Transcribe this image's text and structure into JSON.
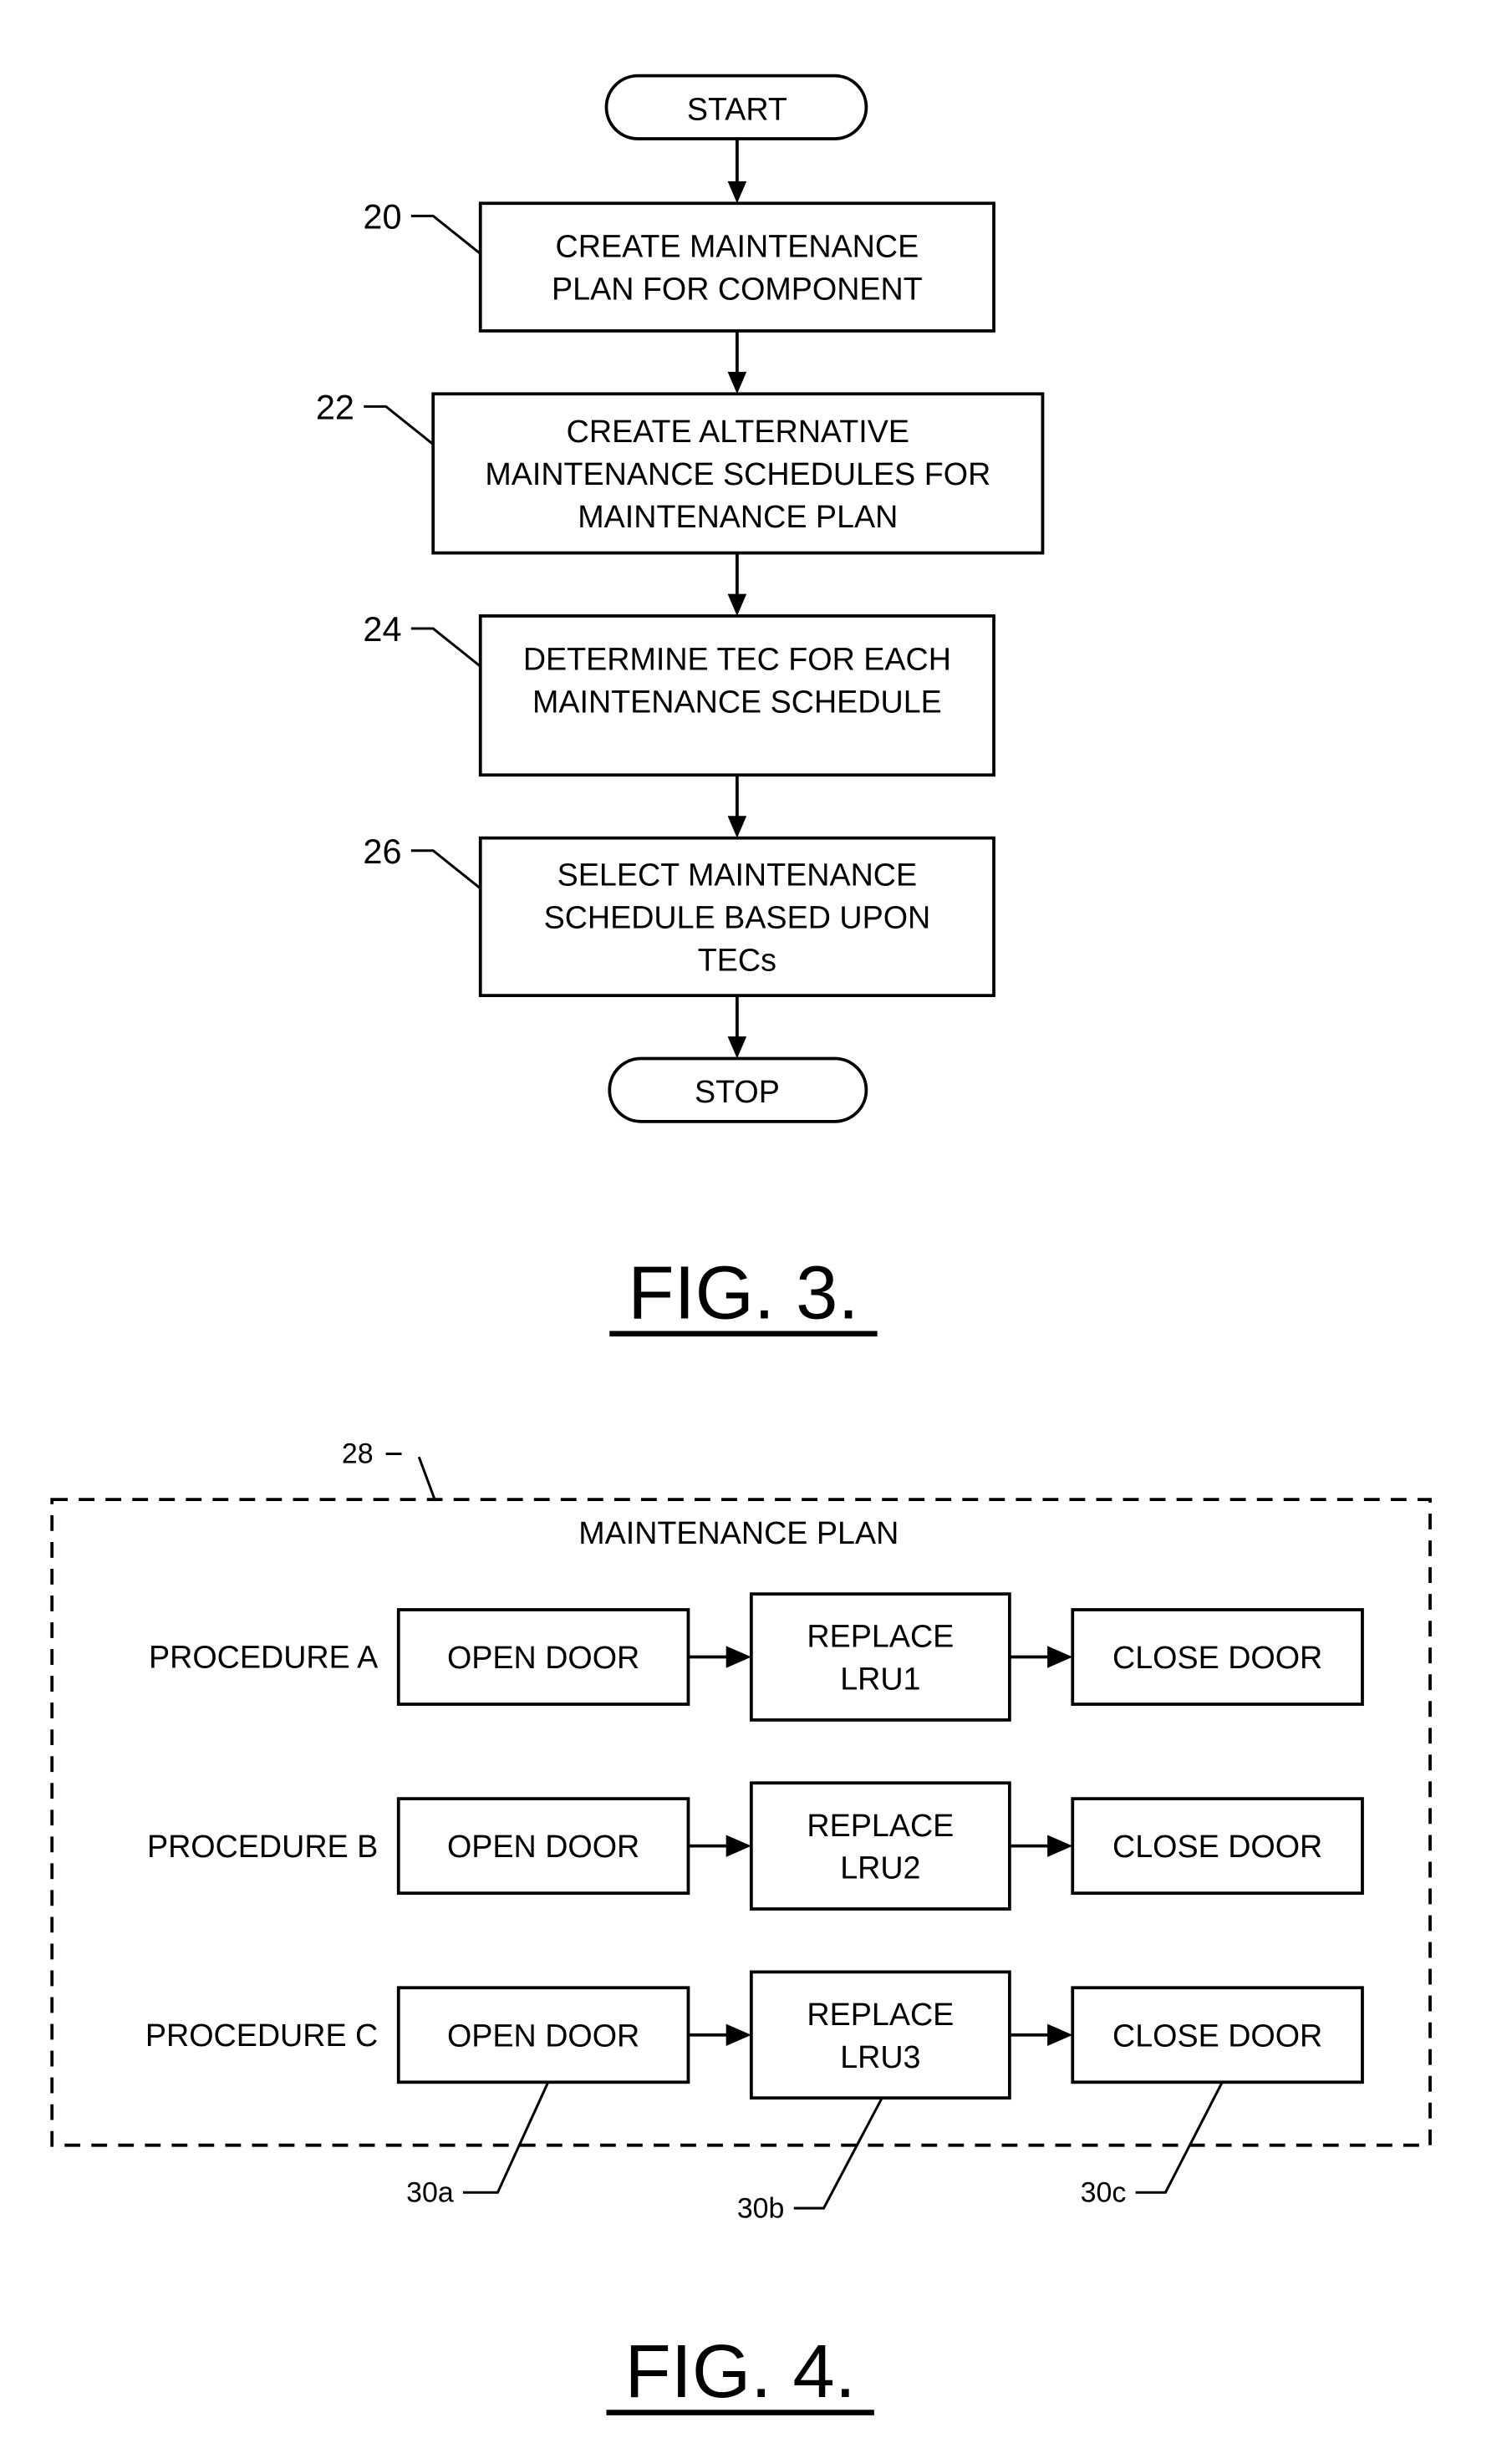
{
  "fig3": {
    "start_label": "START",
    "stop_label": "STOP",
    "caption": "FIG. 3.",
    "steps": [
      {
        "ref": "20",
        "lines": [
          "CREATE MAINTENANCE",
          "PLAN FOR COMPONENT"
        ]
      },
      {
        "ref": "22",
        "lines": [
          "CREATE ALTERNATIVE",
          "MAINTENANCE SCHEDULES FOR",
          "MAINTENANCE PLAN"
        ]
      },
      {
        "ref": "24",
        "lines": [
          "DETERMINE TEC FOR EACH",
          "MAINTENANCE SCHEDULE"
        ]
      },
      {
        "ref": "26",
        "lines": [
          "SELECT MAINTENANCE",
          "SCHEDULE BASED UPON",
          "TECs"
        ]
      }
    ]
  },
  "fig4": {
    "ref": "28",
    "title": "MAINTENANCE PLAN",
    "caption": "FIG. 4.",
    "procedures": [
      {
        "label": "PROCEDURE A",
        "steps": [
          [
            "OPEN DOOR"
          ],
          [
            "REPLACE",
            "LRU1"
          ],
          [
            "CLOSE DOOR"
          ]
        ]
      },
      {
        "label": "PROCEDURE B",
        "steps": [
          [
            "OPEN DOOR"
          ],
          [
            "REPLACE",
            "LRU2"
          ],
          [
            "CLOSE DOOR"
          ]
        ]
      },
      {
        "label": "PROCEDURE C",
        "steps": [
          [
            "OPEN DOOR"
          ],
          [
            "REPLACE",
            "LRU3"
          ],
          [
            "CLOSE DOOR"
          ]
        ]
      }
    ],
    "step_refs": [
      "30a",
      "30b",
      "30c"
    ]
  }
}
